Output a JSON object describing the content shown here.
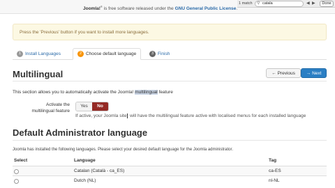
{
  "top_notice": {
    "brand": "Joomla!",
    "mark": "®",
    "text": " is free software released under the ",
    "license": "GNU General Public License",
    "end": "."
  },
  "find_bar": {
    "match_count": "1 match",
    "query": "catala",
    "done_label": "Done"
  },
  "alert": {
    "text": "Press the 'Previous' button if you want to install more languages."
  },
  "tabs": [
    {
      "num": "1",
      "label": "Install Languages"
    },
    {
      "num": "2",
      "label": "Choose default language"
    },
    {
      "num": "3",
      "label": "Finish"
    }
  ],
  "multilingual": {
    "title": "Multilingual",
    "prev_label": "Previous",
    "next_label": "Next",
    "desc_before": "This section allows you to automatically activate the Joomla! ",
    "desc_highlight": "multilingual",
    "desc_after": " feature",
    "control_label": "Activate the multilingual feature",
    "yes_label": "Yes",
    "no_label": "No",
    "help_before": "If active, your Joomla site",
    "help_after": " will have the multilingual feature active with localised menus for each installed language"
  },
  "admin": {
    "title": "Default Administrator language",
    "desc": "Joomla has installed the following languages. Please select your desired default language for the Joomla administrator."
  },
  "table": {
    "headers": {
      "select": "Select",
      "language": "Language",
      "tag": "Tag"
    },
    "rows": [
      {
        "language": "Catalan (Català - ca_ES)",
        "tag": "ca-ES"
      },
      {
        "language": "Dutch (NL)",
        "tag": "nl-NL"
      }
    ]
  },
  "colors": {
    "accent": "#2b7fc4",
    "no_active": "#942a25",
    "alert_bg": "#fcf8e3",
    "step_active": "#f89406"
  }
}
